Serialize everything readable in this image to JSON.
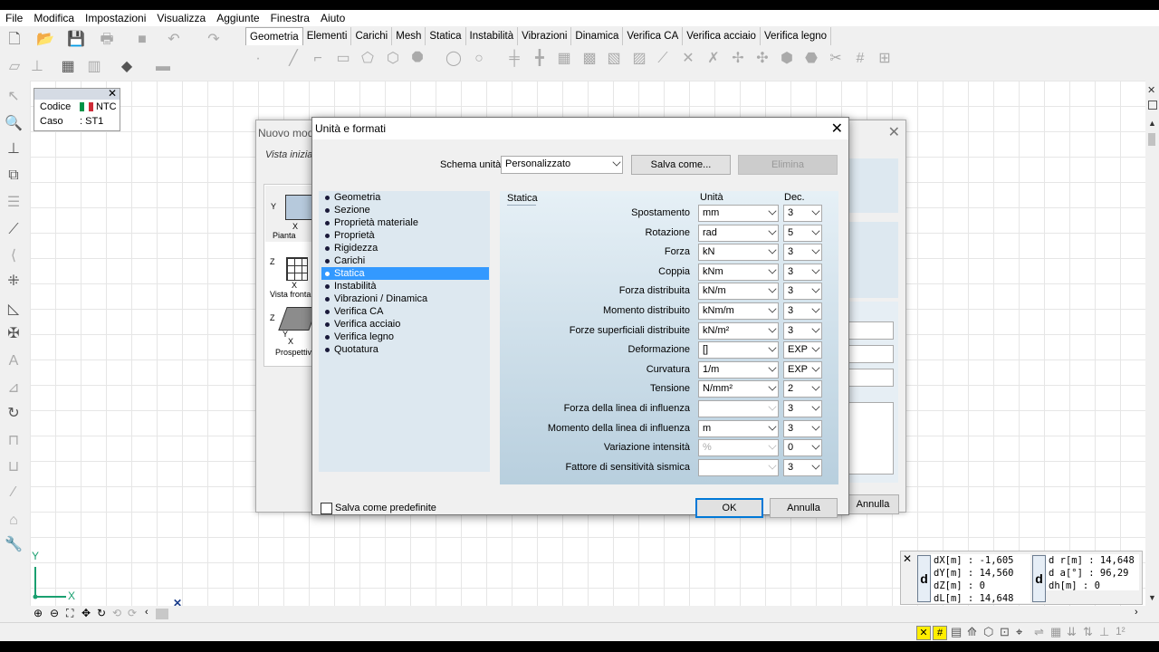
{
  "menu": [
    "File",
    "Modifica",
    "Impostazioni",
    "Visualizza",
    "Aggiunte",
    "Finestra",
    "Aiuto"
  ],
  "module_tabs": [
    "Geometria",
    "Elementi",
    "Carichi",
    "Mesh",
    "Statica",
    "Instabilità",
    "Vibrazioni",
    "Dinamica",
    "Verifica CA",
    "Verifica acciaio",
    "Verifica legno"
  ],
  "info_box": {
    "codice_label": "Codice",
    "codice_value": "NTC",
    "caso_label": "Caso",
    "caso_value": ": ST1"
  },
  "axes": {
    "x": "X",
    "y": "Y"
  },
  "back_dialog": {
    "title": "Nuovo mod",
    "subtitle": "Vista inizia",
    "views": [
      "Pianta",
      "Vista fronta",
      "Prospettiv"
    ],
    "cancel_label": "Annulla"
  },
  "dialog": {
    "title": "Unità e formati",
    "scheme_label": "Schema unità",
    "scheme_value": "Personalizzato",
    "save_as_label": "Salva come...",
    "delete_label": "Elimina",
    "categories": [
      "Geometria",
      "Sezione",
      "Proprietà materiale",
      "Proprietà",
      "Rigidezza",
      "Carichi",
      "Statica",
      "Instabilità",
      "Vibrazioni / Dinamica",
      "Verifica CA",
      "Verifica acciaio",
      "Verifica legno",
      "Quotatura"
    ],
    "selected_category": "Statica",
    "section_title": "Statica",
    "col_unit": "Unità",
    "col_dec": "Dec.",
    "rows": [
      {
        "label": "Spostamento",
        "unit": "mm",
        "dec": "3",
        "unit_enabled": true
      },
      {
        "label": "Rotazione",
        "unit": "rad",
        "dec": "5",
        "unit_enabled": true
      },
      {
        "label": "Forza",
        "unit": "kN",
        "dec": "3",
        "unit_enabled": true
      },
      {
        "label": "Coppia",
        "unit": "kNm",
        "dec": "3",
        "unit_enabled": true
      },
      {
        "label": "Forza distribuita",
        "unit": "kN/m",
        "dec": "3",
        "unit_enabled": true
      },
      {
        "label": "Momento distribuito",
        "unit": "kNm/m",
        "dec": "3",
        "unit_enabled": true
      },
      {
        "label": "Forze superficiali distribuite",
        "unit": "kN/m²",
        "dec": "3",
        "unit_enabled": true
      },
      {
        "label": "Deformazione",
        "unit": "[]",
        "dec": "EXP",
        "unit_enabled": true
      },
      {
        "label": "Curvatura",
        "unit": "1/m",
        "dec": "EXP",
        "unit_enabled": true
      },
      {
        "label": "Tensione",
        "unit": "N/mm²",
        "dec": "2",
        "unit_enabled": true
      },
      {
        "label": "Forza della linea di influenza",
        "unit": "",
        "dec": "3",
        "unit_enabled": false
      },
      {
        "label": "Momento della linea di influenza",
        "unit": "m",
        "dec": "3",
        "unit_enabled": true
      },
      {
        "label": "Variazione intensità",
        "unit": "%",
        "dec": "0",
        "unit_enabled": false
      },
      {
        "label": "Fattore di sensitività sismica",
        "unit": "",
        "dec": "3",
        "unit_enabled": false
      }
    ],
    "save_default_label": "Salva come predefinite",
    "ok_label": "OK",
    "cancel_label": "Annulla"
  },
  "coords": {
    "badge": "d",
    "left": [
      "dX[m] : -1,605",
      "dY[m] : 14,560",
      "dZ[m] : 0",
      "dL[m] : 14,648"
    ],
    "right": [
      "d r[m] : 14,648",
      "d a[°] : 96,29",
      "dh[m] : 0"
    ]
  }
}
